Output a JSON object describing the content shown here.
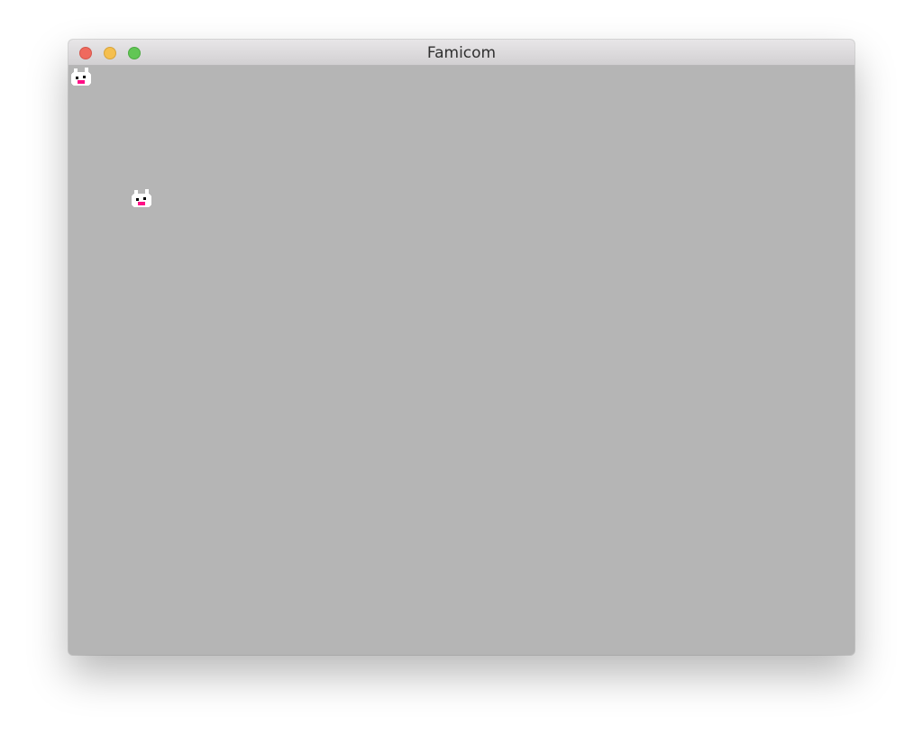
{
  "window": {
    "title": "Famicom",
    "controls": {
      "close_icon": "close-icon",
      "minimize_icon": "minimize-icon",
      "zoom_icon": "zoom-icon"
    }
  },
  "display": {
    "background_color": "#b5b5b5",
    "sprites": [
      {
        "icon": "cat-face-sprite-icon",
        "body_color": "#ffffff",
        "mouth_color": "#ff0f86",
        "eye_color": "#000000"
      },
      {
        "icon": "cat-face-sprite-icon",
        "body_color": "#ffffff",
        "mouth_color": "#ff0f86",
        "eye_color": "#000000"
      }
    ]
  }
}
